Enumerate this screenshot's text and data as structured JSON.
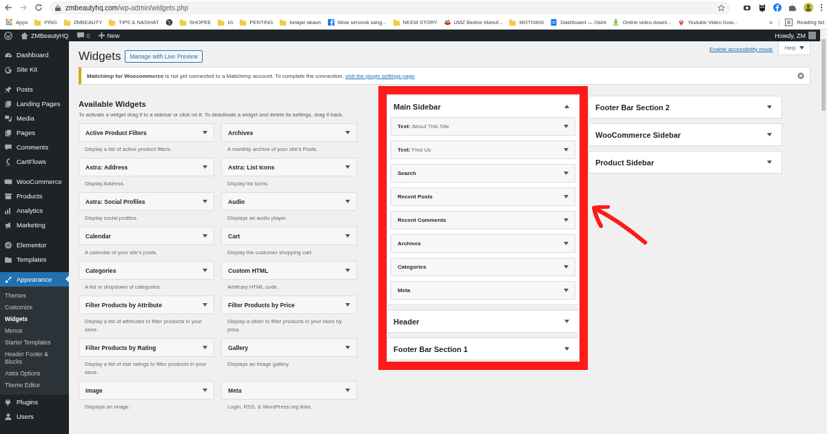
{
  "browser": {
    "url_host": "zmbeautyhq.com",
    "url_path": "/wp-admin/widgets.php",
    "bookmarks": [
      {
        "label": "Apps",
        "kind": "apps"
      },
      {
        "label": "PING",
        "kind": "folder"
      },
      {
        "label": "ZMBEAUTY",
        "kind": "folder"
      },
      {
        "label": "TIPS & NASIHAT",
        "kind": "folder"
      },
      {
        "kind": "globe"
      },
      {
        "label": "SHOPEE",
        "kind": "folder"
      },
      {
        "label": "IG",
        "kind": "folder"
      },
      {
        "label": "PENTING",
        "kind": "folder"
      },
      {
        "label": "belajar akaun",
        "kind": "folder"
      },
      {
        "label": "Wow seronok sang...",
        "kind": "fbook"
      },
      {
        "label": "NEEM STORY",
        "kind": "folder"
      },
      {
        "label": "UMZ Bioline Manuf...",
        "kind": "bowl"
      },
      {
        "label": "MOTIVASI",
        "kind": "folder"
      },
      {
        "label": "Dashboard — Osini",
        "kind": "doc"
      },
      {
        "label": "Online video downl...",
        "kind": "download"
      },
      {
        "label": "Youtube Video Dow...",
        "kind": "pin"
      }
    ],
    "more": "»",
    "reading_list": "Reading list"
  },
  "admin_bar": {
    "site": "ZMBeautyHQ",
    "comments": "0",
    "new": "New",
    "howdy": "Howdy, ZM"
  },
  "menu_groups": [
    [
      {
        "label": "Dashboard",
        "kind": "gauge",
        "selected": false
      },
      {
        "label": "Site Kit",
        "kind": "g",
        "selected": false
      }
    ],
    [
      {
        "label": "Posts",
        "kind": "pin",
        "selected": false
      },
      {
        "label": "Landing Pages",
        "kind": "pages",
        "selected": false
      },
      {
        "label": "Media",
        "kind": "media",
        "selected": false
      },
      {
        "label": "Pages",
        "kind": "pages",
        "selected": false
      },
      {
        "label": "Comments",
        "kind": "comment",
        "selected": false
      },
      {
        "label": "CartFlows",
        "kind": "cf",
        "selected": false
      }
    ],
    [
      {
        "label": "WooCommerce",
        "kind": "woo",
        "selected": false
      },
      {
        "label": "Products",
        "kind": "archive",
        "selected": false
      },
      {
        "label": "Analytics",
        "kind": "bars",
        "selected": false
      },
      {
        "label": "Marketing",
        "kind": "megaphone",
        "selected": false
      }
    ],
    [
      {
        "label": "Elementor",
        "kind": "elementor",
        "selected": false
      },
      {
        "label": "Templates",
        "kind": "folder",
        "selected": false
      }
    ],
    [
      {
        "label": "Appearance",
        "kind": "brush",
        "selected": true,
        "children": [
          {
            "label": "Themes",
            "selected": false
          },
          {
            "label": "Customize",
            "selected": false
          },
          {
            "label": "Widgets",
            "selected": true
          },
          {
            "label": "Menus",
            "selected": false
          },
          {
            "label": "Starter Templates",
            "selected": false
          },
          {
            "label": "Header Footer & Blocks",
            "selected": false
          },
          {
            "label": "Astra Options",
            "selected": false
          },
          {
            "label": "Theme Editor",
            "selected": false
          }
        ]
      },
      {
        "label": "Plugins",
        "kind": "plug",
        "selected": false
      },
      {
        "label": "Users",
        "kind": "user",
        "selected": false
      }
    ]
  ],
  "page": {
    "title": "Widgets",
    "action": "Manage with Live Preview",
    "accessibility_link": "Enable accessibility mode",
    "help": "Help"
  },
  "notice": {
    "text": "**Mailchimp for Woocommerce** is not yet connected to a Mailchimp account. To complete the connection, ",
    "link": "visit the plugin settings page",
    "end": "."
  },
  "available": {
    "title": "Available Widgets",
    "hint": "To activate a widget drag it to a sidebar or click on it. To deactivate a widget and delete its settings, drag it back.",
    "widgets": [
      {
        "name": "Active Product Filters",
        "description": "Display a list of active product filters."
      },
      {
        "name": "Archives",
        "description": "A monthly archive of your site’s Posts."
      },
      {
        "name": "Astra: Address",
        "description": "Display Address."
      },
      {
        "name": "Astra: List Icons",
        "description": "Display list icons."
      },
      {
        "name": "Astra: Social Profiles",
        "description": "Display social profiles."
      },
      {
        "name": "Audio",
        "description": "Displays an audio player."
      },
      {
        "name": "Calendar",
        "description": "A calendar of your site’s posts."
      },
      {
        "name": "Cart",
        "description": "Display the customer shopping cart."
      },
      {
        "name": "Categories",
        "description": "A list or dropdown of categories."
      },
      {
        "name": "Custom HTML",
        "description": "Arbitrary HTML code."
      },
      {
        "name": "Filter Products by Attribute",
        "description": "Display a list of attributes to filter products in your store."
      },
      {
        "name": "Filter Products by Price",
        "description": "Display a slider to filter products in your store by price."
      },
      {
        "name": "Filter Products by Rating",
        "description": "Display a list of star ratings to filter products in your store."
      },
      {
        "name": "Gallery",
        "description": "Displays an image gallery."
      },
      {
        "name": "Image",
        "description": "Displays an image."
      },
      {
        "name": "Meta",
        "description": "Login, RSS, & WordPress.org links."
      }
    ]
  },
  "sidebars": [
    {
      "name": "Main Sidebar",
      "expanded": true,
      "widgets": [
        {
          "name": "Text:",
          "title": "About This Site"
        },
        {
          "name": "Text:",
          "title": "Find Us"
        },
        {
          "name": "Search"
        },
        {
          "name": "Recent Posts"
        },
        {
          "name": "Recent Comments"
        },
        {
          "name": "Archives"
        },
        {
          "name": "Categories"
        },
        {
          "name": "Meta"
        }
      ]
    },
    {
      "name": "Header",
      "expanded": false
    },
    {
      "name": "Footer Bar Section 1",
      "expanded": false
    }
  ],
  "sidebars_right": [
    {
      "name": "Footer Bar Section 2",
      "expanded": false
    },
    {
      "name": "WooCommerce Sidebar",
      "expanded": false
    },
    {
      "name": "Product Sidebar",
      "expanded": false
    }
  ]
}
